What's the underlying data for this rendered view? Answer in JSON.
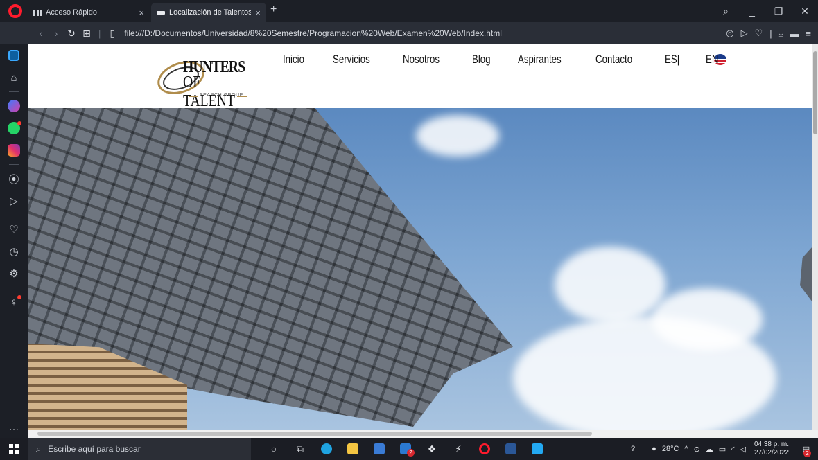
{
  "browser": {
    "tabs": [
      {
        "title": "Acceso Rápido",
        "active": false
      },
      {
        "title": "Localización de Talentos | N",
        "active": true
      }
    ],
    "new_tab_symbol": "+",
    "url": "file:///D:/Documentos/Universidad/8%20Semestre/Programacion%20Web/Examen%20Web/Index.html"
  },
  "site": {
    "logo": {
      "line1": "HUNTERS",
      "line2": "OF TALENT",
      "line3": "SEARCH GROUP"
    },
    "menu": [
      {
        "label": "Inicio"
      },
      {
        "label": "Servicios"
      },
      {
        "label": "Nosotros"
      },
      {
        "label": "Blog"
      },
      {
        "label": "Aspirantes"
      },
      {
        "label": "Contacto"
      },
      {
        "label": "ES|"
      },
      {
        "label": "EN"
      }
    ]
  },
  "taskbar": {
    "search_placeholder": "Escribe aquí para buscar",
    "badges": {
      "mail": "2",
      "notifications": "2"
    },
    "weather": "28°C",
    "time": "04:38 p. m.",
    "date": "27/02/2022"
  },
  "colors": {
    "opera_red": "#ff1b2d",
    "logo_gold": "#b08d4c",
    "sky_blue": "#5b89c0"
  }
}
